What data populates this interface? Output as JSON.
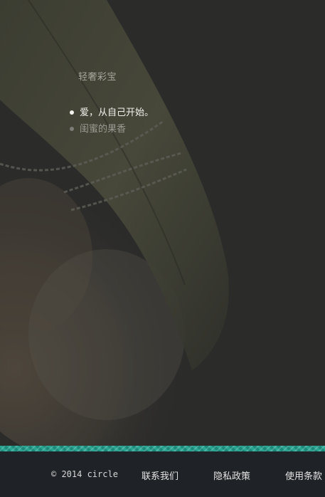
{
  "brand": {
    "name": "轻奢彩宝"
  },
  "menu": {
    "items": [
      {
        "label": "爱，从自己开始。",
        "state": "active"
      },
      {
        "label": "闺蜜的果香",
        "state": "inactive"
      }
    ]
  },
  "footer": {
    "copyright": "© 2014 circle",
    "links": {
      "contact": "联系我们",
      "privacy": "隐私政策",
      "terms": "使用条款"
    }
  },
  "colors": {
    "background": "#2b2b2a",
    "footer": "#1f2226",
    "accent_stripe": "#2aa592"
  }
}
